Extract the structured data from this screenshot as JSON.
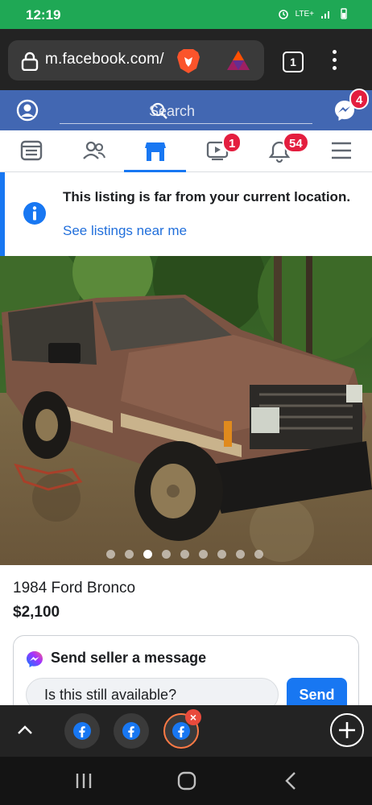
{
  "status_bar": {
    "time": "12:19",
    "network": "LTE+"
  },
  "browser": {
    "url": "m.facebook.com/",
    "tab_count": "1",
    "icons": [
      "lock-icon",
      "brave-lion-icon",
      "bat-rewards-icon",
      "more-vertical-icon"
    ]
  },
  "fb_header": {
    "search_placeholder": "Search",
    "messenger_badge": "4"
  },
  "fb_nav": {
    "tabs": [
      "news-feed",
      "friends",
      "marketplace",
      "watch",
      "notifications",
      "menu"
    ],
    "watch_badge": "1",
    "notifications_badge": "54",
    "active_tab": "marketplace"
  },
  "notice": {
    "title": "This listing is far from your current location.",
    "link": "See listings near me"
  },
  "photo": {
    "dot_count": 9,
    "active_dot": 2
  },
  "listing": {
    "title": "1984 Ford Bronco",
    "price": "$2,100"
  },
  "message": {
    "heading": "Send seller a message",
    "input_value": "Is this still available?",
    "send_label": "Send"
  },
  "tab_switcher": {
    "close_glyph": "×",
    "tab_icons": [
      "facebook-icon",
      "facebook-icon",
      "facebook-icon"
    ]
  },
  "colors": {
    "status_green": "#1fa855",
    "facebook_blue": "#4267b2",
    "link_blue": "#1877f2",
    "badge_red": "#e41e3f"
  }
}
